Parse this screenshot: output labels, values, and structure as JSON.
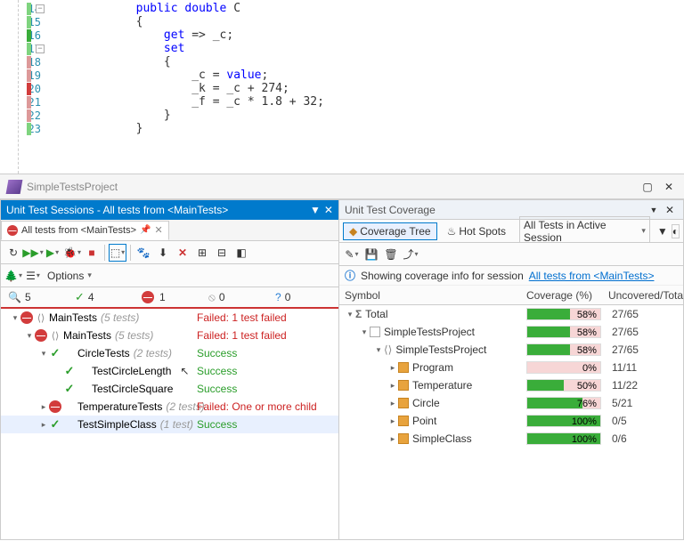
{
  "code": {
    "lines": [
      {
        "n": 14,
        "text": "public double C",
        "collapse": true,
        "mark": "#7fd47f"
      },
      {
        "n": 15,
        "text": "{",
        "mark": "#7fd47f"
      },
      {
        "n": 16,
        "text": "    get => _c;",
        "mark": "#3aad3a"
      },
      {
        "n": 17,
        "text": "    set",
        "collapse": true,
        "mark": "#7fd47f"
      },
      {
        "n": 18,
        "text": "    {",
        "mark": "#d99"
      },
      {
        "n": 19,
        "text": "        _c = value;",
        "mark": "#d99"
      },
      {
        "n": 20,
        "text": "        _k = _c + 274;",
        "mark": "#d23c3c",
        "hl": true
      },
      {
        "n": 21,
        "text": "        _f = _c * 1.8 + 32;",
        "mark": "#d99"
      },
      {
        "n": 22,
        "text": "    }",
        "mark": "#d99"
      },
      {
        "n": 23,
        "text": "}",
        "mark": "#7fd47f"
      }
    ]
  },
  "window_title": "SimpleTestsProject",
  "left": {
    "header": "Unit Test Sessions - All tests from <MainTests>",
    "tab_label": "All tests from <MainTests>",
    "options_label": "Options",
    "filters": {
      "total": "5",
      "pass": "4",
      "fail": "1",
      "skip": "0",
      "info": "0"
    },
    "tree": [
      {
        "depth": 0,
        "tw": "▾",
        "status": "fail",
        "type": "⟨⟩",
        "name": "MainTests",
        "count": "(5 tests)",
        "st": "Failed: 1 test failed",
        "stc": "fail"
      },
      {
        "depth": 1,
        "tw": "▾",
        "status": "fail",
        "type": "⟨⟩",
        "name": "MainTests",
        "count": "(5 tests)",
        "st": "Failed: 1 test failed",
        "stc": "fail"
      },
      {
        "depth": 2,
        "tw": "▾",
        "status": "pass",
        "type": "",
        "name": "CircleTests",
        "count": "(2 tests)",
        "st": "Success",
        "stc": "pass"
      },
      {
        "depth": 3,
        "tw": "",
        "status": "pass",
        "type": "",
        "name": "TestCircleLength",
        "count": "",
        "st": "Success",
        "stc": "pass",
        "cursor": true
      },
      {
        "depth": 3,
        "tw": "",
        "status": "pass",
        "type": "",
        "name": "TestCircleSquare",
        "count": "",
        "st": "Success",
        "stc": "pass"
      },
      {
        "depth": 2,
        "tw": "▸",
        "status": "fail",
        "type": "",
        "name": "TemperatureTests",
        "count": "(2 tests)",
        "st": "Failed: One or more child",
        "stc": "fail"
      },
      {
        "depth": 2,
        "tw": "▸",
        "status": "pass",
        "type": "",
        "name": "TestSimpleClass",
        "count": "(1 test)",
        "st": "Success",
        "stc": "pass",
        "selected": true
      }
    ]
  },
  "right": {
    "header": "Unit Test Coverage",
    "tab1": "Coverage Tree",
    "tab2": "Hot Spots",
    "select": "All Tests in Active Session",
    "info_text": "Showing coverage info for session",
    "info_link": "All tests from <MainTests>",
    "cols": {
      "c1": "Symbol",
      "c2": "Coverage (%)",
      "c3": "Uncovered/Tota"
    },
    "rows": [
      {
        "depth": 0,
        "tw": "▾",
        "ico": "sigma",
        "name": "Total",
        "pct": 58,
        "u": "27/65"
      },
      {
        "depth": 1,
        "tw": "▾",
        "ico": "proj",
        "name": "SimpleTestsProject",
        "pct": 58,
        "u": "27/65"
      },
      {
        "depth": 2,
        "tw": "▾",
        "ico": "ns",
        "name": "SimpleTestsProject",
        "pct": 58,
        "u": "27/65"
      },
      {
        "depth": 3,
        "tw": "▸",
        "ico": "cls",
        "name": "Program",
        "pct": 0,
        "u": "11/11"
      },
      {
        "depth": 3,
        "tw": "▸",
        "ico": "cls",
        "name": "Temperature",
        "pct": 50,
        "u": "11/22"
      },
      {
        "depth": 3,
        "tw": "▸",
        "ico": "cls",
        "name": "Circle",
        "pct": 76,
        "u": "5/21"
      },
      {
        "depth": 3,
        "tw": "▸",
        "ico": "cls",
        "name": "Point",
        "pct": 100,
        "u": "0/5"
      },
      {
        "depth": 3,
        "tw": "▸",
        "ico": "cls",
        "name": "SimpleClass",
        "pct": 100,
        "u": "0/6"
      }
    ]
  }
}
